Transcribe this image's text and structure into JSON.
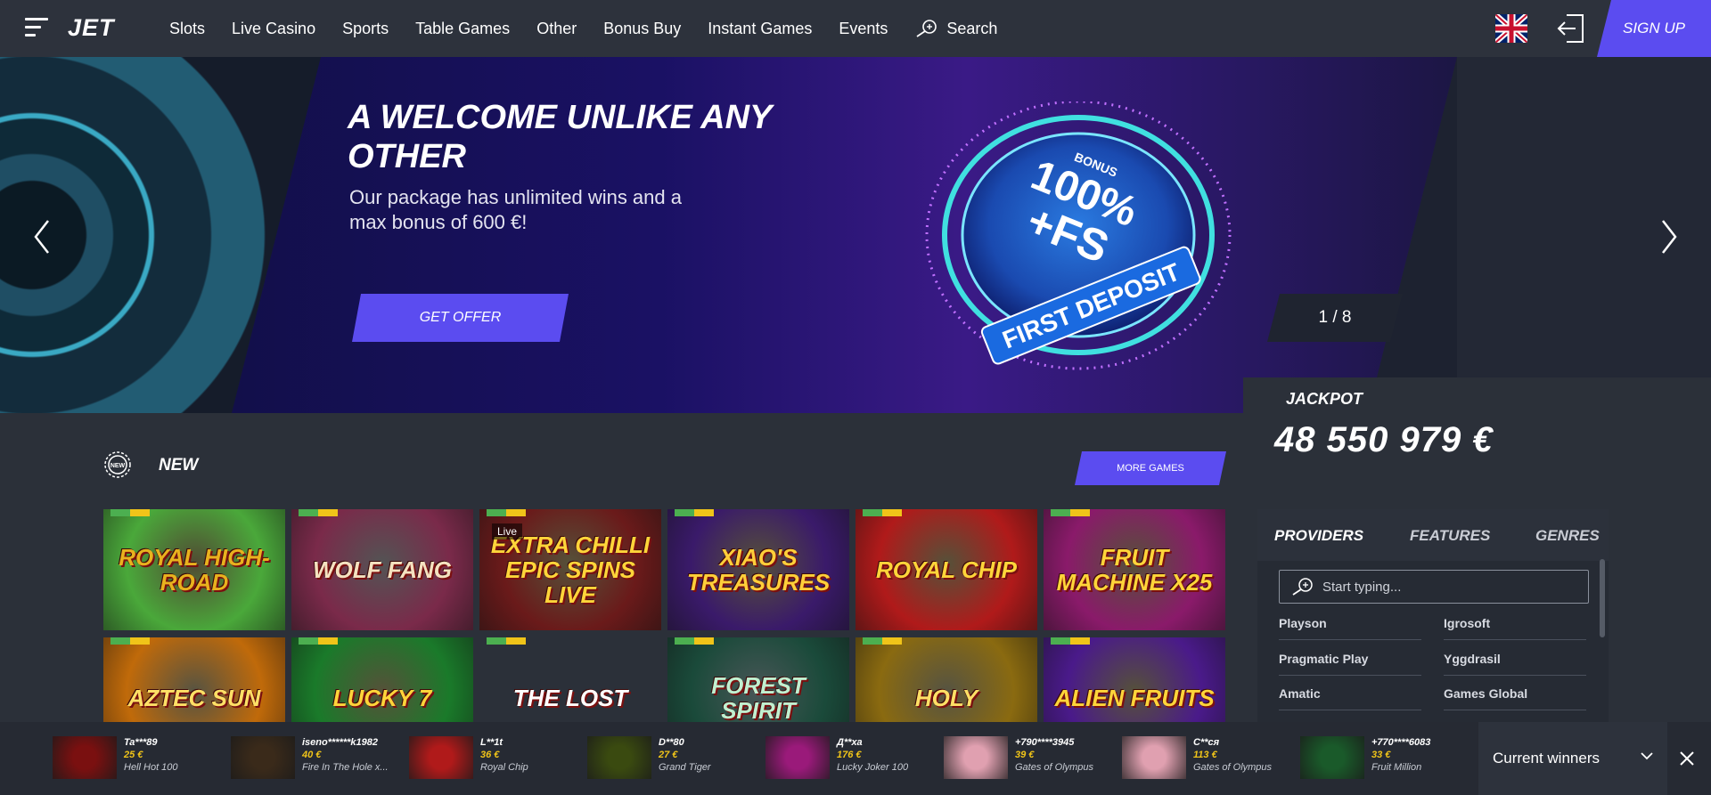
{
  "header": {
    "logo": "JET",
    "nav": [
      "Slots",
      "Live Casino",
      "Sports",
      "Table Games",
      "Other",
      "Bonus Buy",
      "Instant Games",
      "Events"
    ],
    "search_label": "Search",
    "signup_label": "SIGN UP",
    "language_icon": "uk-flag-icon",
    "login_icon": "login-icon"
  },
  "banner": {
    "title": "A WELCOME UNLIKE ANY OTHER",
    "subtitle": "Our package has unlimited wins and a max bonus of 600 €!",
    "cta_label": "GET OFFER",
    "disc_top": "BONUS",
    "disc_main": "100%",
    "disc_fs": "+FS",
    "disc_ring": "FIRST DEPOSIT",
    "slide_counter": "1 / 8"
  },
  "jackpot": {
    "label": "JACKPOT",
    "value": "48 550 979 €"
  },
  "new_section": {
    "icon_text": "NEW",
    "title": "NEW",
    "more_label": "MORE GAMES",
    "live_badge": "Live",
    "games": [
      {
        "name": "Royal High-Road",
        "bg": "#4aa83a",
        "fg": "#e8b21e"
      },
      {
        "name": "Wolf Fang",
        "bg": "#7a2a4a",
        "fg": "#f4e2c0"
      },
      {
        "name": "Extra Chilli Epic Spins Live",
        "bg": "#6a1a1a",
        "fg": "#ffd53a"
      },
      {
        "name": "Xiao's Treasures",
        "bg": "#3a1a6a",
        "fg": "#ffcf3a"
      },
      {
        "name": "Royal Chip",
        "bg": "#b01a1a",
        "fg": "#ffd53a"
      },
      {
        "name": "Fruit Machine x25",
        "bg": "#8a1a6a",
        "fg": "#ffd53a"
      },
      {
        "name": "Aztec Sun",
        "bg": "#c06a0a",
        "fg": "#ffe066"
      },
      {
        "name": "Lucky 7",
        "bg": "#1a7a2a",
        "fg": "#ffd53a"
      },
      {
        "name": "The Lost",
        "bg": "#e08a1a",
        "fg": "#fff"
      },
      {
        "name": "Forest Spirit",
        "bg": "#1a4a3a",
        "fg": "#c0f0d0"
      },
      {
        "name": "Holy",
        "bg": "#8a6a10",
        "fg": "#ffe066"
      },
      {
        "name": "Alien Fruits",
        "bg": "#4a1a8a",
        "fg": "#ffd53a"
      }
    ]
  },
  "filters": {
    "tabs": [
      "PROVIDERS",
      "FEATURES",
      "GENRES"
    ],
    "search_placeholder": "Start typing...",
    "providers": [
      "Playson",
      "Igrosoft",
      "Pragmatic Play",
      "Yggdrasil",
      "Amatic",
      "Games Global"
    ]
  },
  "winners": {
    "items": [
      {
        "user": "Ta***89",
        "amount": "25 €",
        "game": "Hell Hot 100",
        "bg": "#7a1010"
      },
      {
        "user": "iseno******k1982",
        "amount": "40 €",
        "game": "Fire In The Hole x...",
        "bg": "#3a2a1a"
      },
      {
        "user": "L**1t",
        "amount": "36 €",
        "game": "Royal Chip",
        "bg": "#b01a1a"
      },
      {
        "user": "D**80",
        "amount": "27 €",
        "game": "Grand Tiger",
        "bg": "#3a4a10"
      },
      {
        "user": "Д**ха",
        "amount": "176 €",
        "game": "Lucky Joker 100",
        "bg": "#9a1a7a"
      },
      {
        "user": "+790****3945",
        "amount": "39 €",
        "game": "Gates of Olympus",
        "bg": "#e0a0b0"
      },
      {
        "user": "C**ся",
        "amount": "113 €",
        "game": "Gates of Olympus",
        "bg": "#e0a0b0"
      },
      {
        "user": "+770****6083",
        "amount": "33 €",
        "game": "Fruit Million",
        "bg": "#1a5a2a"
      }
    ],
    "current_label": "Current winners"
  },
  "colors": {
    "accent": "#5b4cf0",
    "header_bg": "#2d323c",
    "page_bg": "#2b3039"
  }
}
